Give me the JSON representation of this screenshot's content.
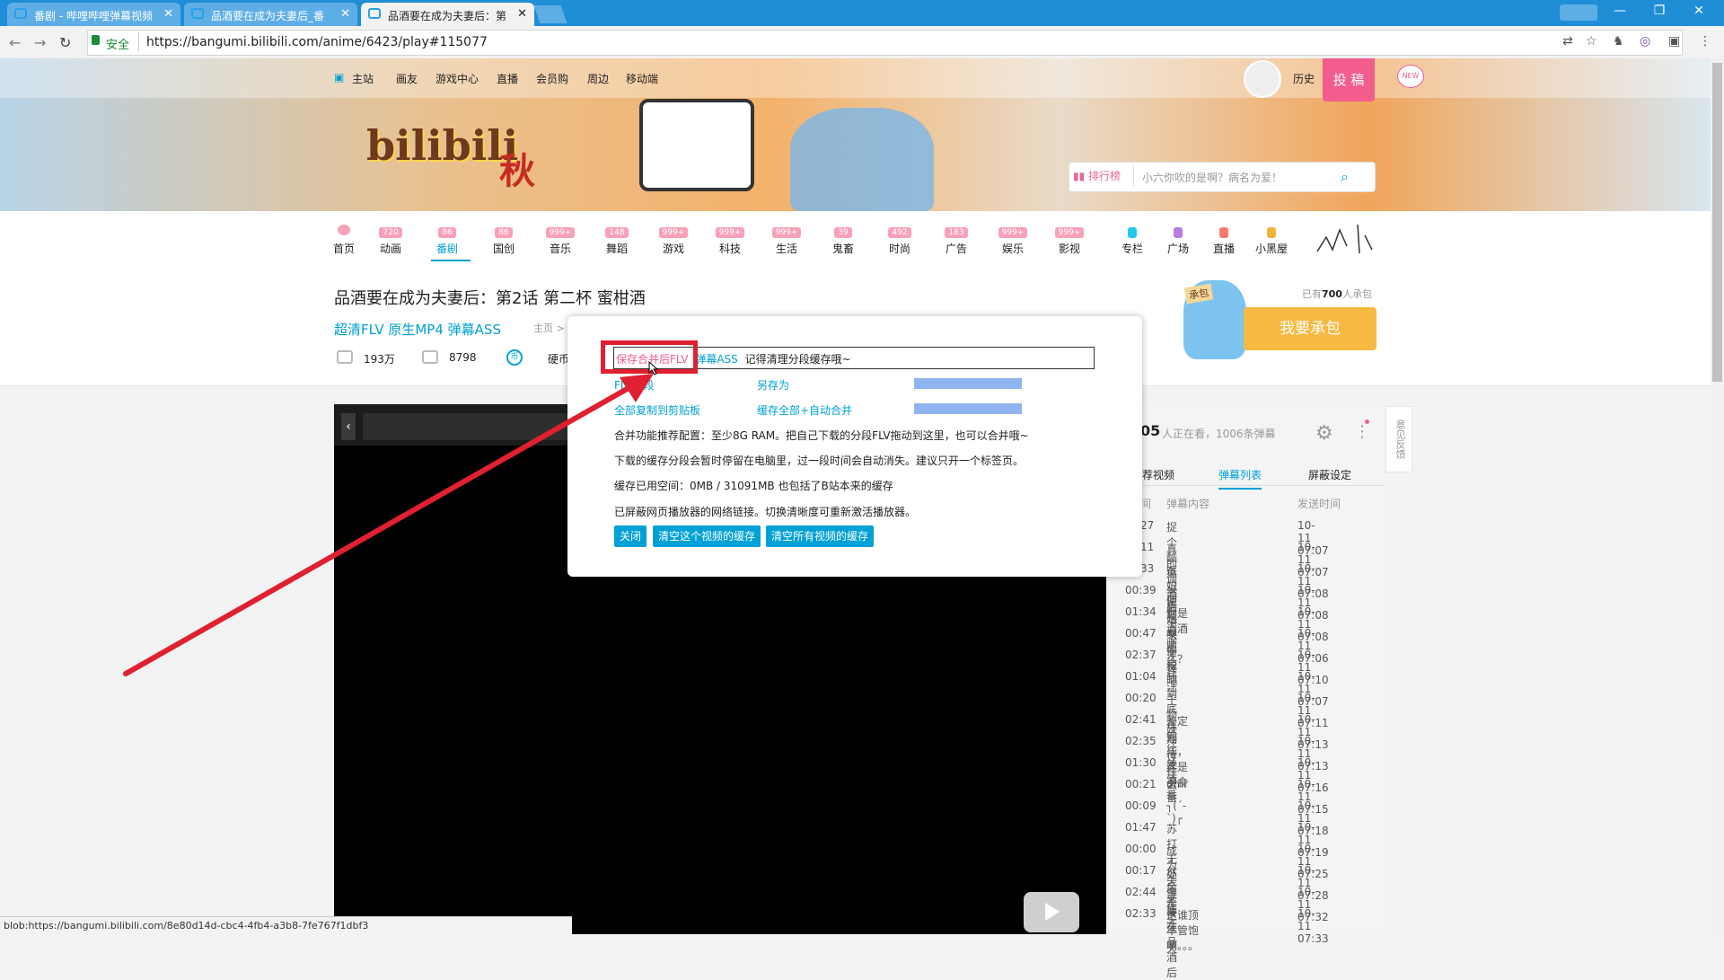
{
  "browser": {
    "tabs": [
      {
        "label": "番剧 - 哔哩哔哩弹幕视频"
      },
      {
        "label": "品酒要在成为夫妻后_番"
      },
      {
        "label": "品酒要在成为夫妻后：第"
      }
    ],
    "security": "安全",
    "url": "https://bangumi.bilibili.com/anime/6423/play#115077",
    "status_url": "blob:https://bangumi.bilibili.com/8e80d14d-cbc4-4fb4-a3b8-7fe767f1dbf3"
  },
  "topnav": {
    "items": [
      "主站",
      "画友",
      "游戏中心",
      "直播",
      "会员购",
      "周边",
      "移动端"
    ],
    "history": "历史",
    "upload": "投 稿",
    "new_badge": "NEW"
  },
  "banner": {
    "logo": "bilibili",
    "season": "秋",
    "rank": "排行榜",
    "search_placeholder": "小六你吹的是啊？病名为爱！"
  },
  "categories": [
    {
      "name": "首页",
      "count": ""
    },
    {
      "name": "动画",
      "count": "720"
    },
    {
      "name": "番剧",
      "count": "86"
    },
    {
      "name": "国创",
      "count": "86"
    },
    {
      "name": "音乐",
      "count": "999+"
    },
    {
      "name": "舞蹈",
      "count": "148"
    },
    {
      "name": "游戏",
      "count": "999+"
    },
    {
      "name": "科技",
      "count": "999+"
    },
    {
      "name": "生活",
      "count": "999+"
    },
    {
      "name": "鬼畜",
      "count": "39"
    },
    {
      "name": "时尚",
      "count": "492"
    },
    {
      "name": "广告",
      "count": "183"
    },
    {
      "name": "娱乐",
      "count": "999+"
    },
    {
      "name": "影视",
      "count": "999+"
    }
  ],
  "extra_nav": [
    "专栏",
    "广场",
    "直播",
    "小黑屋"
  ],
  "video": {
    "title": "品酒要在成为夫妻后：第2话 第二杯 蜜柑酒",
    "links": "超清FLV 原生MP4 弹幕ASS",
    "breadcrumb": "主页 >",
    "plays": "193万",
    "danmaku": "8798",
    "coin": "硬币"
  },
  "chengbao": {
    "count_prefix": "已有",
    "count": "700",
    "count_suffix": "人承包",
    "button": "我要承包",
    "tag": "承包"
  },
  "dialog": {
    "save_merge": "保存合并后FLV",
    "danmaku_ass": "弹幕ASS",
    "hint": "记得清理分段缓存哦~",
    "flv_segments": "FLV分段",
    "save_as": "另存为",
    "copy_clipboard": "全部复制到剪贴板",
    "cache_merge": "缓存全部+自动合并",
    "line1": "合并功能推荐配置：至少8G RAM。把自己下载的分段FLV拖动到这里，也可以合并哦~",
    "line2": "下载的缓存分段会暂时停留在电脑里，过一段时间会自动消失。建议只开一个标签页。",
    "line3": "缓存已用空间：0MB / 31091MB 也包括了B站本来的缓存",
    "line4": "已屏蔽网页播放器的网络链接。切换清晰度可重新激活播放器。",
    "btn_close": "关闭",
    "btn_clear_this": "清空这个视频的缓存",
    "btn_clear_all": "清空所有视频的缓存"
  },
  "panel": {
    "viewers_num": "05",
    "viewers_text": "人正在看，1006条弹幕",
    "tabs": [
      "荐视频",
      "弹幕列表",
      "屏蔽设定"
    ],
    "headers": [
      "间",
      "弹幕内容",
      "发送时间"
    ],
    "feedback": "意见反馈",
    "rows": [
      {
        "t": "27",
        "c": "捉个酷鱼小姐姐呗",
        "d": "10-11 07:07"
      },
      {
        "t": "11",
        "c": "真的调酒师",
        "d": "10-11 07:07"
      },
      {
        "t": "33",
        "d": "10-11 07:08",
        "c": "嫉妒使我丑陋"
      },
      {
        "t": "00:39",
        "c": "然后干了个爽",
        "d": "10-11 07:08"
      },
      {
        "t": "01:34",
        "c": "你是调酒师么？",
        "d": "10-11 07:08"
      },
      {
        "t": "00:47",
        "c": "来偷税吧",
        "d": "10-11 07:06"
      },
      {
        "t": "02:37",
        "c": "汪汪汪",
        "d": "10-11 07:10"
      },
      {
        "t": "01:04",
        "c": "我到底在期待什么",
        "d": "10-11 07:07"
      },
      {
        "t": "00:20",
        "c": "干物妹",
        "d": "10-11 07:11"
      },
      {
        "t": "02:41",
        "c": "鉴定完毕，这是美食番",
        "d": "10-11 07:13"
      },
      {
        "t": "02:35",
        "c": "汪汪汪",
        "d": "10-11 07:13"
      },
      {
        "t": "01:30",
        "c": "美酒番",
        "d": "10-11 07:16"
      },
      {
        "t": "00:21",
        "c": "umr",
        "d": "10-11 07:15"
      },
      {
        "t": "00:09",
        "c": "┐(´-`)┌",
        "d": "10-11 07:18"
      },
      {
        "t": "01:47",
        "c": "苏打无处不在",
        "d": "10-11 07:19"
      },
      {
        "t": "00:00",
        "c": "成为夫妻要在品酒后",
        "d": "10-11 07:25"
      },
      {
        "t": "00:17",
        "c": "然后干了一天",
        "d": "10-11 07:28"
      },
      {
        "t": "02:44",
        "c": "汪汪汪",
        "d": "10-11 07:32"
      },
      {
        "t": "02:33",
        "c": "这谁顶不管饱啊。。。",
        "d": "10-11 07:33"
      }
    ]
  },
  "colors": {
    "accent": "#00a1d6",
    "pink": "#f25d8e",
    "annotation_red": "#e02030"
  }
}
